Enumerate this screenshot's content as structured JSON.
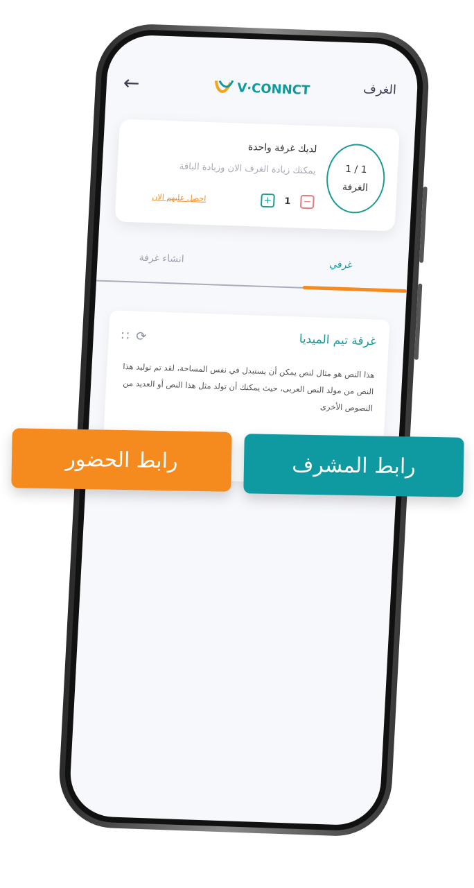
{
  "header": {
    "title": "الغرف",
    "logo_text": "V·CONNCT",
    "back_icon": "arrow-left-icon"
  },
  "summary": {
    "count_label": "1 / 1",
    "count_unit": "الغرفة",
    "line1": "لديك غرفة واحدة",
    "line2": "يمكنك زيادة الغرف الان وزيادة الباقة",
    "quantity": "1",
    "get_link": "احصل عليهم الان"
  },
  "tabs": [
    {
      "label": "غرفي",
      "active": true
    },
    {
      "label": "انشاء غرفة",
      "active": false
    }
  ],
  "room": {
    "title": "غرفة تيم الميديا",
    "description": "هذا النص هو مثال لنص يمكن أن يستبدل في نفس المساحة، لقد تم توليد هذا النص من مولد النص العربى، حيث يمكنك أن تولد مثل هذا النص أو العديد من النصوص الأخرى"
  },
  "buttons": {
    "attendance": "رابط الحضور",
    "moderator": "رابط المشرف"
  },
  "colors": {
    "teal": "#0e9aa0",
    "orange": "#f58b1f",
    "red": "#e77a7a"
  }
}
